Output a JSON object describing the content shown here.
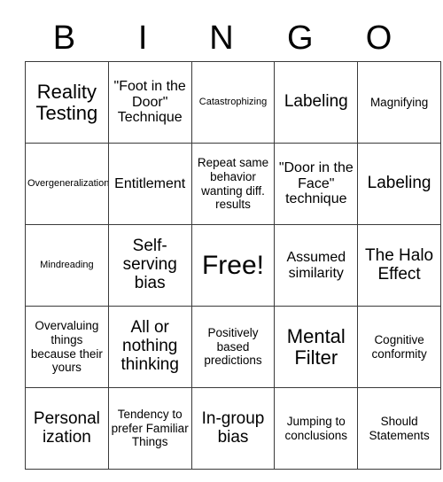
{
  "card": {
    "header_letters": [
      "B",
      "I",
      "N",
      "G",
      "O"
    ],
    "rows": [
      [
        {
          "text": "Reality Testing",
          "size": "fs-xl"
        },
        {
          "text": "\"Foot in the Door\" Technique",
          "size": "fs-m"
        },
        {
          "text": "Catastrophizing",
          "size": "fs-xs"
        },
        {
          "text": "Labeling",
          "size": "fs-l"
        },
        {
          "text": "Magnifying",
          "size": "fs-s"
        }
      ],
      [
        {
          "text": "Overgeneralization",
          "size": "fs-xs"
        },
        {
          "text": "Entitlement",
          "size": "fs-m"
        },
        {
          "text": "Repeat same behavior wanting diff. results",
          "size": "fs-s"
        },
        {
          "text": "\"Door in the Face\" technique",
          "size": "fs-m"
        },
        {
          "text": "Labeling",
          "size": "fs-l"
        }
      ],
      [
        {
          "text": "Mindreading",
          "size": "fs-xs"
        },
        {
          "text": "Self-serving bias",
          "size": "fs-l"
        },
        {
          "text": "Free!",
          "size": "fs-xxl"
        },
        {
          "text": "Assumed similarity",
          "size": "fs-m"
        },
        {
          "text": "The Halo Effect",
          "size": "fs-l"
        }
      ],
      [
        {
          "text": "Overvaluing things because their yours",
          "size": "fs-s"
        },
        {
          "text": "All or nothing thinking",
          "size": "fs-l"
        },
        {
          "text": "Positively based predictions",
          "size": "fs-s"
        },
        {
          "text": "Mental Filter",
          "size": "fs-xl"
        },
        {
          "text": "Cognitive conformity",
          "size": "fs-s"
        }
      ],
      [
        {
          "text": "Personal ization",
          "size": "fs-l"
        },
        {
          "text": "Tendency to prefer Familiar Things",
          "size": "fs-s"
        },
        {
          "text": "In-group bias",
          "size": "fs-l"
        },
        {
          "text": "Jumping to conclusions",
          "size": "fs-s"
        },
        {
          "text": "Should Statements",
          "size": "fs-s"
        }
      ]
    ]
  }
}
